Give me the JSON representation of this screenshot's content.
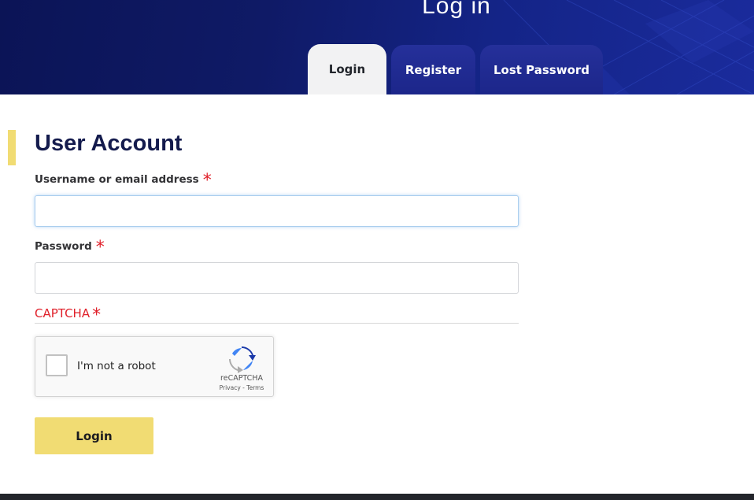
{
  "header": {
    "title": "Log in",
    "tabs": [
      {
        "label": "Login",
        "active": true
      },
      {
        "label": "Register",
        "active": false
      },
      {
        "label": "Lost Password",
        "active": false
      }
    ]
  },
  "section": {
    "title": "User Account"
  },
  "form": {
    "username": {
      "label": "Username or email address",
      "required_mark": "*",
      "value": ""
    },
    "password": {
      "label": "Password",
      "required_mark": "*",
      "value": ""
    },
    "captcha": {
      "label": "CAPTCHA",
      "required_mark": "*"
    },
    "recaptcha": {
      "checkbox_label": "I'm not a robot",
      "brand": "reCAPTCHA",
      "privacy_link": "Privacy",
      "separator": "-",
      "terms_link": "Terms",
      "logo_icon": "recaptcha-logo-icon"
    },
    "submit_label": "Login"
  },
  "colors": {
    "header_bg": "#0f1a66",
    "tab_active_bg": "#f2f2f3",
    "tab_inactive_bg": "#25309a",
    "accent_yellow": "#f1dc73",
    "required_red": "#e0202a",
    "title_navy": "#141b4d"
  }
}
